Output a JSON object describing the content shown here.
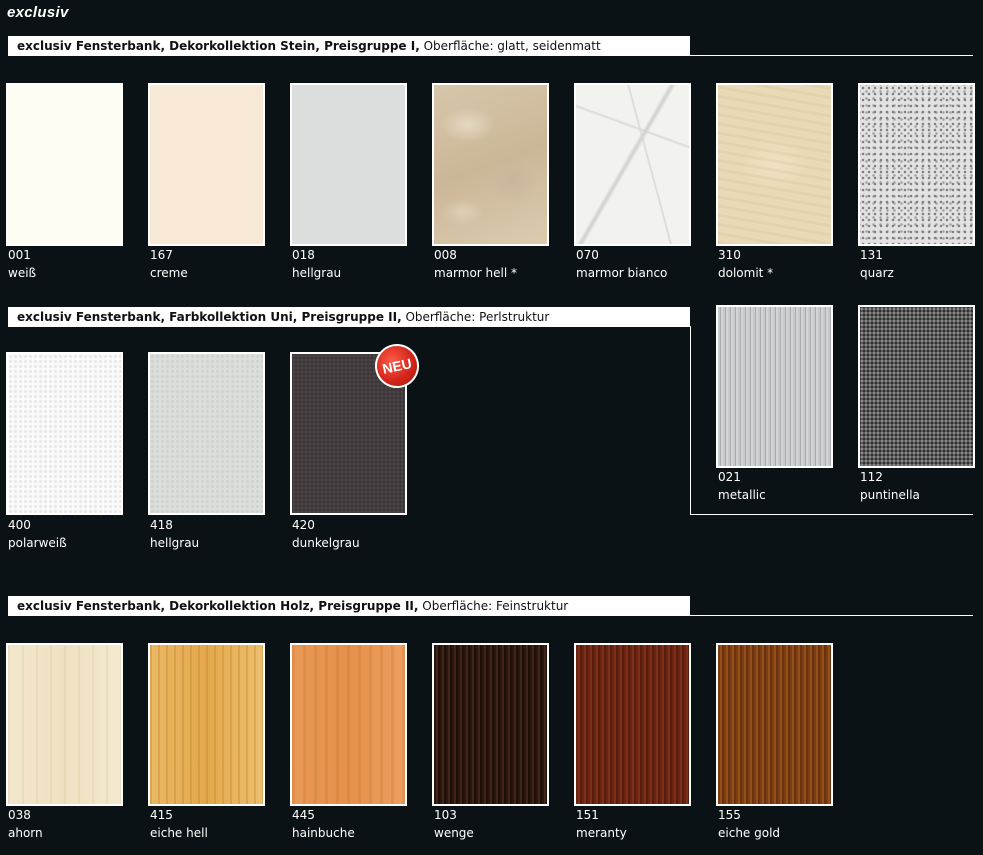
{
  "brand": "exclusiv",
  "sections": [
    {
      "bold": "exclusiv Fensterbank, Dekorkollektion Stein, Preisgruppe I,",
      "normal": " Oberfläche: glatt, seidenmatt",
      "swatches": [
        {
          "code": "001",
          "name": "weiß",
          "color": "#fdfdf3"
        },
        {
          "code": "167",
          "name": "creme",
          "color": "#f8e9d6"
        },
        {
          "code": "018",
          "name": "hellgrau",
          "color": "#dcdddd"
        },
        {
          "code": "008",
          "name": "marmor hell *",
          "color": "#d8c6aa"
        },
        {
          "code": "070",
          "name": "marmor bianco",
          "color": "#f2f2ef"
        },
        {
          "code": "310",
          "name": "dolomit *",
          "color": "#ead9b6"
        },
        {
          "code": "131",
          "name": "quarz",
          "color": "#e2e2e2"
        }
      ]
    },
    {
      "bold": "exclusiv Fensterbank, Farbkollektion Uni, Preisgruppe II,",
      "normal": " Oberfläche: Perlstruktur",
      "badge": "NEU",
      "swatches": [
        {
          "code": "400",
          "name": "polarweiß",
          "color": "#fbfbfb"
        },
        {
          "code": "418",
          "name": "hellgrau",
          "color": "#dcdedc"
        },
        {
          "code": "420",
          "name": "dunkelgrau",
          "color": "#3a3436"
        },
        {
          "code": "021",
          "name": "metallic",
          "color": "#bfc3c4"
        },
        {
          "code": "112",
          "name": "puntinella",
          "color": "#5c5c5c"
        }
      ]
    },
    {
      "bold": "exclusiv Fensterbank, Dekorkollektion Holz, Preisgruppe II,",
      "normal": " Oberfläche: Feinstruktur",
      "swatches": [
        {
          "code": "038",
          "name": "ahorn",
          "color": "#f3e7cc"
        },
        {
          "code": "415",
          "name": "eiche hell",
          "color": "#e3a84c"
        },
        {
          "code": "445",
          "name": "hainbuche",
          "color": "#e4904a"
        },
        {
          "code": "103",
          "name": "wenge",
          "color": "#2d180f"
        },
        {
          "code": "151",
          "name": "meranty",
          "color": "#6b2614"
        },
        {
          "code": "155",
          "name": "eiche gold",
          "color": "#834315"
        }
      ]
    }
  ]
}
